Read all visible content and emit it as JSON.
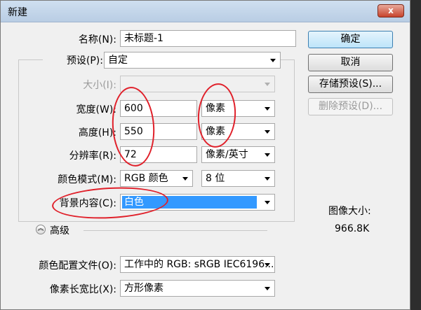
{
  "window": {
    "title": "新建",
    "close_label": "x"
  },
  "name": {
    "label": "名称(N):",
    "value": "未标题-1"
  },
  "preset": {
    "label": "预设(P):",
    "value": "自定"
  },
  "size": {
    "label": "大小(I):",
    "value": ""
  },
  "width": {
    "label": "宽度(W):",
    "value": "600",
    "unit": "像素"
  },
  "height": {
    "label": "高度(H):",
    "value": "550",
    "unit": "像素"
  },
  "resolution": {
    "label": "分辨率(R):",
    "value": "72",
    "unit": "像素/英寸"
  },
  "color_mode": {
    "label": "颜色模式(M):",
    "mode": "RGB 颜色",
    "depth": "8 位"
  },
  "background": {
    "label": "背景内容(C):",
    "value": "白色"
  },
  "advanced": {
    "label": "高级"
  },
  "color_profile": {
    "label": "颜色配置文件(O):",
    "value": "工作中的 RGB: sRGB IEC6196..."
  },
  "pixel_aspect": {
    "label": "像素长宽比(X):",
    "value": "方形像素"
  },
  "buttons": {
    "ok": "确定",
    "cancel": "取消",
    "save_preset": "存储预设(S)...",
    "delete_preset": "删除预设(D)..."
  },
  "image_size": {
    "label": "图像大小:",
    "value": "966.8K"
  },
  "colors": {
    "annotation": "#e0202a",
    "selection": "#3399ff"
  }
}
